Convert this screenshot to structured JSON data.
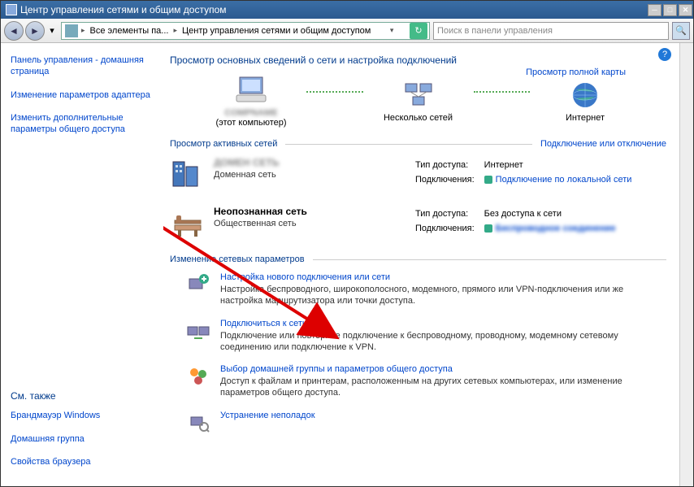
{
  "window_title": "Центр управления сетями и общим доступом",
  "breadcrumb": {
    "seg1": "Все элементы па...",
    "seg2": "Центр управления сетями и общим доступом"
  },
  "search_placeholder": "Поиск в панели управления",
  "sidebar": {
    "home": "Панель управления - домашняя страница",
    "adapter": "Изменение параметров адаптера",
    "sharing": "Изменить дополнительные параметры общего доступа",
    "see_also_hdr": "См. также",
    "firewall": "Брандмауэр Windows",
    "homegroup": "Домашняя группа",
    "browser": "Свойства браузера"
  },
  "main": {
    "heading": "Просмотр основных сведений о сети и настройка подключений",
    "map_link": "Просмотр полной карты",
    "node_computer": "(этот компьютер)",
    "node_networks": "Несколько сетей",
    "node_internet": "Интернет",
    "active_hdr": "Просмотр активных сетей",
    "conn_disc": "Подключение или отключение",
    "net1_name": "ДОМЕН СЕТЬ",
    "net1_sub": "Доменная сеть",
    "net2_name": "Неопознанная сеть",
    "net2_sub": "Общественная сеть",
    "access_label": "Тип доступа:",
    "conn_label": "Подключения:",
    "net1_access": "Интернет",
    "net1_conn": "Подключение по локальной сети",
    "net2_access": "Без доступа к сети",
    "net2_conn": "Беспроводное соединение",
    "change_hdr": "Изменение сетевых параметров",
    "act1_title": "Настройка нового подключения или сети",
    "act1_desc": "Настройка беспроводного, широкополосного, модемного, прямого или VPN-подключения или же настройка маршрутизатора или точки доступа.",
    "act2_title": "Подключиться к сети",
    "act2_desc": "Подключение или повторное подключение к беспроводному, проводному, модемному сетевому соединению или подключение к VPN.",
    "act3_title": "Выбор домашней группы и параметров общего доступа",
    "act3_desc": "Доступ к файлам и принтерам, расположенным на других сетевых компьютерах, или изменение параметров общего доступа.",
    "act4_title": "Устранение неполадок"
  }
}
